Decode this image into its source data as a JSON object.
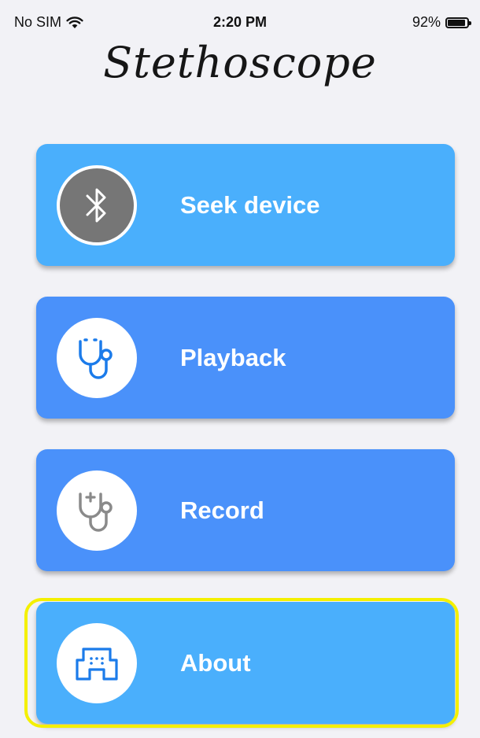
{
  "status_bar": {
    "carrier": "No SIM",
    "time": "2:20 PM",
    "battery_percent": "92%",
    "battery_level": 0.92,
    "icons": [
      "wifi-icon",
      "battery-icon"
    ]
  },
  "app": {
    "title": "Stethoscope"
  },
  "menu": {
    "items": [
      {
        "label": "Seek device",
        "icon": "bluetooth-icon",
        "color": "#4aaffc"
      },
      {
        "label": "Playback",
        "icon": "stethoscope-icon",
        "color": "#4a91fa"
      },
      {
        "label": "Record",
        "icon": "stethoscope-plus-icon",
        "color": "#4a91fa"
      },
      {
        "label": "About",
        "icon": "building-icon",
        "color": "#4aaffc"
      }
    ]
  },
  "colors": {
    "background": "#f2f2f6",
    "highlight": "#f4f000",
    "bluetooth_circle": "#767676",
    "icon_blue": "#1b7bea",
    "icon_gray": "#8a8a8a"
  }
}
